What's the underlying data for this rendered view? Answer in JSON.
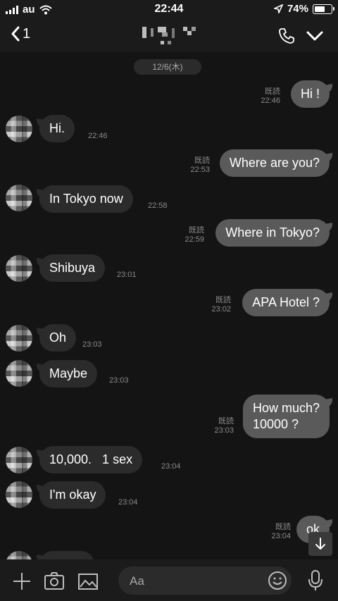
{
  "status": {
    "carrier": "au",
    "time": "22:44",
    "battery": "74%",
    "battery_level": 0.74
  },
  "header": {
    "back_count": "1"
  },
  "date_divider": "12/6(木)",
  "messages": [
    {
      "dir": "out",
      "text": "Hi !",
      "read": "既読",
      "time": "22:46"
    },
    {
      "dir": "in",
      "text": "Hi.",
      "time": "22:46"
    },
    {
      "dir": "out",
      "text": "Where are you?",
      "read": "既読",
      "time": "22:53"
    },
    {
      "dir": "in",
      "text": "In Tokyo now",
      "time": "22:58"
    },
    {
      "dir": "out",
      "text": "Where in Tokyo?",
      "read": "既読",
      "time": "22:59"
    },
    {
      "dir": "in",
      "text": "Shibuya",
      "time": "23:01"
    },
    {
      "dir": "out",
      "text": "APA Hotel ?",
      "read": "既読",
      "time": "23:02"
    },
    {
      "dir": "in",
      "text": "Oh",
      "time": "23:03"
    },
    {
      "dir": "in",
      "text": "Maybe",
      "time": "23:03"
    },
    {
      "dir": "out",
      "text": "How much?",
      "text2": "10000 ?",
      "read": "既読",
      "time": "23:03"
    },
    {
      "dir": "in",
      "text": "10,000.   1 sex",
      "time": "23:04"
    },
    {
      "dir": "in",
      "text": "I'm okay",
      "time": "23:04"
    },
    {
      "dir": "out",
      "text": "ok",
      "read": "既読",
      "time": "23:04"
    }
  ],
  "composer": {
    "placeholder": "Aa"
  },
  "colors": {
    "background": "#141414",
    "bubble_in": "#2b2b2b",
    "bubble_out": "#5a5a5a",
    "meta": "#8a8a8a"
  },
  "icons": [
    "back-chevron-icon",
    "phone-icon",
    "chevron-down-icon",
    "plus-icon",
    "camera-icon",
    "image-icon",
    "emoji-icon",
    "mic-icon",
    "arrow-down-icon"
  ]
}
